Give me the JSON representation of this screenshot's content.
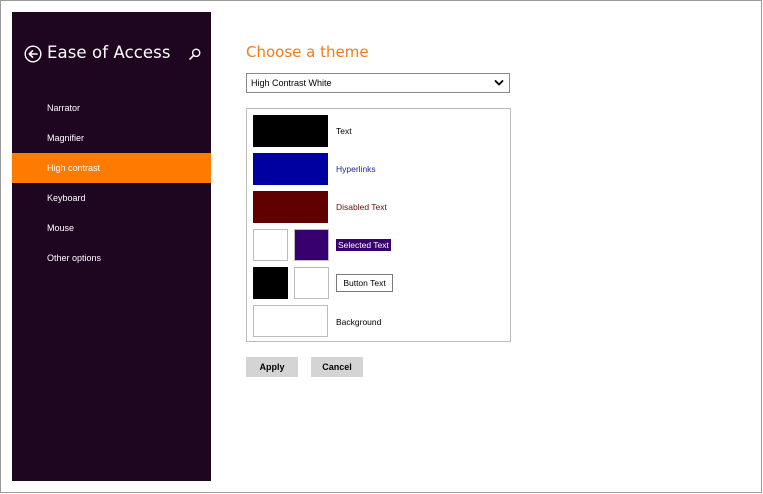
{
  "sidebar": {
    "title": "Ease of Access",
    "items": [
      {
        "label": "Narrator"
      },
      {
        "label": "Magnifier"
      },
      {
        "label": "High contrast"
      },
      {
        "label": "Keyboard"
      },
      {
        "label": "Mouse"
      },
      {
        "label": "Other options"
      }
    ],
    "active_index": 2,
    "back_icon": "back-arrow-circle-icon",
    "search_icon": "search-icon"
  },
  "main": {
    "title": "Choose a theme",
    "theme_select": {
      "value": "High Contrast White"
    },
    "swatches": {
      "text": {
        "label": "Text",
        "color": "#000000"
      },
      "hyperlinks": {
        "label": "Hyperlinks",
        "color": "#0000a0"
      },
      "disabled": {
        "label": "Disabled Text",
        "color": "#600000"
      },
      "selected": {
        "label": "Selected Text",
        "fg": "#ffffff",
        "bg": "#37006e"
      },
      "button": {
        "label": "Button Text",
        "fg": "#000000",
        "bg": "#ffffff"
      },
      "background": {
        "label": "Background",
        "color": "#ffffff"
      }
    },
    "buttons": {
      "apply": "Apply",
      "cancel": "Cancel"
    }
  },
  "colors": {
    "sidebar_bg": "#1e0520",
    "accent": "#ff7a00",
    "title": "#f47a1b"
  }
}
